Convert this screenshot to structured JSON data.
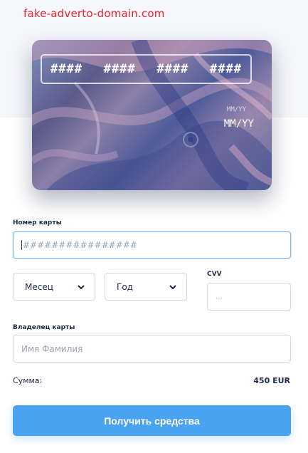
{
  "header": {
    "domain_text": "fake-adverto-domain.com"
  },
  "card_preview": {
    "number_groups": [
      "####",
      "####",
      "####",
      "####"
    ],
    "expiry_label": "MM/YY",
    "expiry_value": "MM/YY"
  },
  "form": {
    "card_number": {
      "label": "Номер карты",
      "placeholder": "################"
    },
    "month_select": {
      "selected": "Месец"
    },
    "year_select": {
      "selected": "Год"
    },
    "cvv": {
      "label": "CVV",
      "placeholder": "..."
    },
    "card_holder": {
      "label": "Владелец карты",
      "placeholder": "Имя Фамилия"
    }
  },
  "summary": {
    "label": "Сумма:",
    "value": "450 EUR"
  },
  "submit_label": "Получить средства",
  "colors": {
    "domain": "#e8242c",
    "button": "#4aa3f0",
    "focus_border": "#7ab4ee"
  }
}
